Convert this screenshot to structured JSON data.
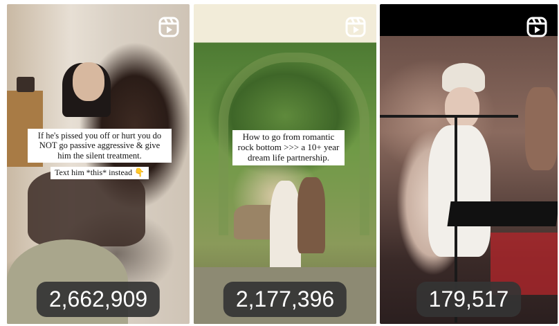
{
  "reels": [
    {
      "icon": "reels-icon",
      "captions": [
        "If he's pissed you off or hurt you do NOT go passive aggressive & give him the silent treatment.",
        "Text him *this* instead 👇"
      ],
      "view_count": "2,662,909"
    },
    {
      "icon": "reels-icon",
      "captions": [
        "How to go from romantic rock bottom >>> a 10+ year dream life partnership."
      ],
      "view_count": "2,177,396"
    },
    {
      "icon": "reels-icon",
      "captions": [],
      "view_count": "179,517"
    }
  ],
  "colors": {
    "pill_bg": "#343434",
    "pill_text": "#ffffff",
    "caption_bg": "#ffffff"
  }
}
